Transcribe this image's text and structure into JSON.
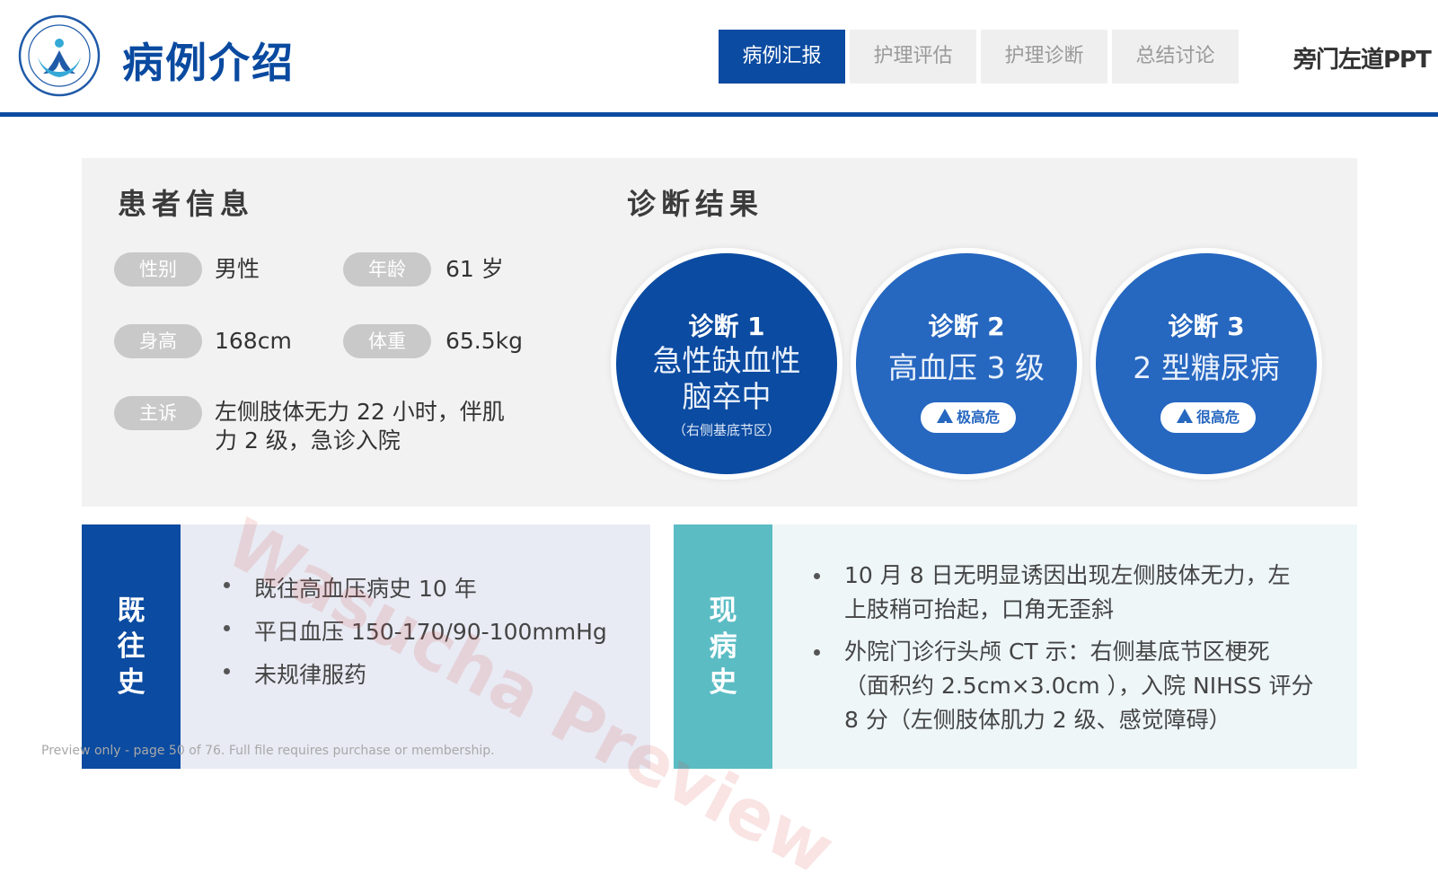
{
  "header": {
    "logo_name": "hospital-logo",
    "title": "病例介绍",
    "tabs": [
      {
        "label": "病例汇报",
        "active": true
      },
      {
        "label": "护理评估",
        "active": false
      },
      {
        "label": "护理诊断",
        "active": false
      },
      {
        "label": "总结讨论",
        "active": false
      }
    ],
    "brand": "旁门左道PPT"
  },
  "patient": {
    "title": "患者信息",
    "gender_label": "性别",
    "gender": "男性",
    "age_label": "年龄",
    "age": "61 岁",
    "height_label": "身高",
    "height": "168cm",
    "weight_label": "体重",
    "weight": "65.5kg",
    "complaint_label": "主诉",
    "complaint_line1": "左侧肢体无力 22 小时，伴肌",
    "complaint_line2": "力 2 级，急诊入院"
  },
  "diagnosis": {
    "title": "诊断结果",
    "items": [
      {
        "head": "诊断 1",
        "line1": "急性缺血性",
        "line2": "脑卒中",
        "sub": "（右侧基底节区）"
      },
      {
        "head": "诊断 2",
        "line1": "高血压 3 级",
        "badge": "极高危"
      },
      {
        "head": "诊断 3",
        "line1": "2 型糖尿病",
        "badge": "很高危"
      }
    ]
  },
  "history": {
    "past": {
      "label_chars": [
        "既",
        "往",
        "史"
      ],
      "items": [
        "既往高血压病史 10 年",
        "平日血压 150-170/90-100mmHg",
        "未规律服药"
      ]
    },
    "present": {
      "label_chars": [
        "现",
        "病",
        "史"
      ],
      "item1_line1": "10 月 8 日无明显诱因出现左侧肢体无力，左",
      "item1_line2": "上肢稍可抬起，口角无歪斜",
      "item2_line1": "外院门诊行头颅 CT 示：右侧基底节区梗死",
      "item2_line2": "（面积约 2.5cm×3.0cm ），入院 NIHSS 评分",
      "item2_line3": "8 分（左侧肢体肌力 2 级、感觉障碍）"
    }
  },
  "watermark": "Wasucha Preview",
  "footer_note": "Preview only - page 50 of 76. Full file requires purchase or membership.",
  "colors": {
    "primary": "#0b4ba1",
    "secondary": "#2667c0",
    "teal": "#5bbcc4",
    "panel": "#f2f2f2"
  }
}
